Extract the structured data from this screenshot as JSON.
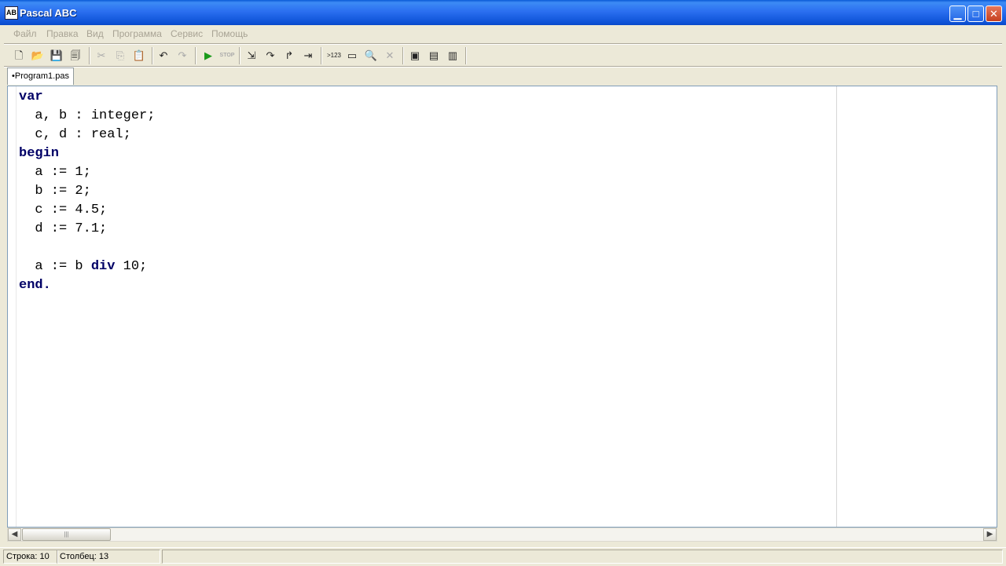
{
  "window": {
    "title": "Pascal ABC",
    "icon_text": "AB"
  },
  "controls": {
    "minimize": "▁",
    "maximize": "□",
    "close": "✕"
  },
  "menu": [
    "Файл",
    "Правка",
    "Вид",
    "Программа",
    "Сервис",
    "Помощь"
  ],
  "toolbar": {
    "new": "🗋",
    "open": "📂",
    "save": "💾",
    "save_all": "🗐",
    "cut": "✂",
    "copy": "⎘",
    "paste": "📋",
    "undo": "↶",
    "redo": "↷",
    "run": "▶",
    "stop": "STOP",
    "step_into": "⇲",
    "step_over": "↷",
    "step_out": "↱",
    "run_to_cursor": "⇥",
    "watch": ">123",
    "output": "▭",
    "find": "🔍",
    "clear": "✕",
    "compile1": "▣",
    "compile2": "▤",
    "compile3": "▥"
  },
  "tabs": [
    {
      "label": "•Program1.pas"
    }
  ],
  "code": {
    "lines": [
      [
        {
          "t": "var",
          "kw": true
        }
      ],
      [
        {
          "t": "  a, b : integer;",
          "kw": false
        }
      ],
      [
        {
          "t": "  c, d : real;",
          "kw": false
        }
      ],
      [
        {
          "t": "begin",
          "kw": true
        }
      ],
      [
        {
          "t": "  a := 1;",
          "kw": false
        }
      ],
      [
        {
          "t": "  b := 2;",
          "kw": false
        }
      ],
      [
        {
          "t": "  c := 4.5;",
          "kw": false
        }
      ],
      [
        {
          "t": "  d := 7.1;",
          "kw": false
        }
      ],
      [
        {
          "t": "",
          "kw": false
        }
      ],
      [
        {
          "t": "  a := b ",
          "kw": false
        },
        {
          "t": "div",
          "kw": true
        },
        {
          "t": " 10;",
          "kw": false
        }
      ],
      [
        {
          "t": "end.",
          "kw": true
        }
      ]
    ]
  },
  "scrollbar": {
    "left_arrow": "◀",
    "right_arrow": "▶",
    "thumb_grip": "|||"
  },
  "status": {
    "row": "Строка: 10",
    "col": "Столбец: 13"
  },
  "colors": {
    "keyword": "#000066",
    "title_bar": "#2b6ff0",
    "menu_disabled": "#a8a394"
  }
}
